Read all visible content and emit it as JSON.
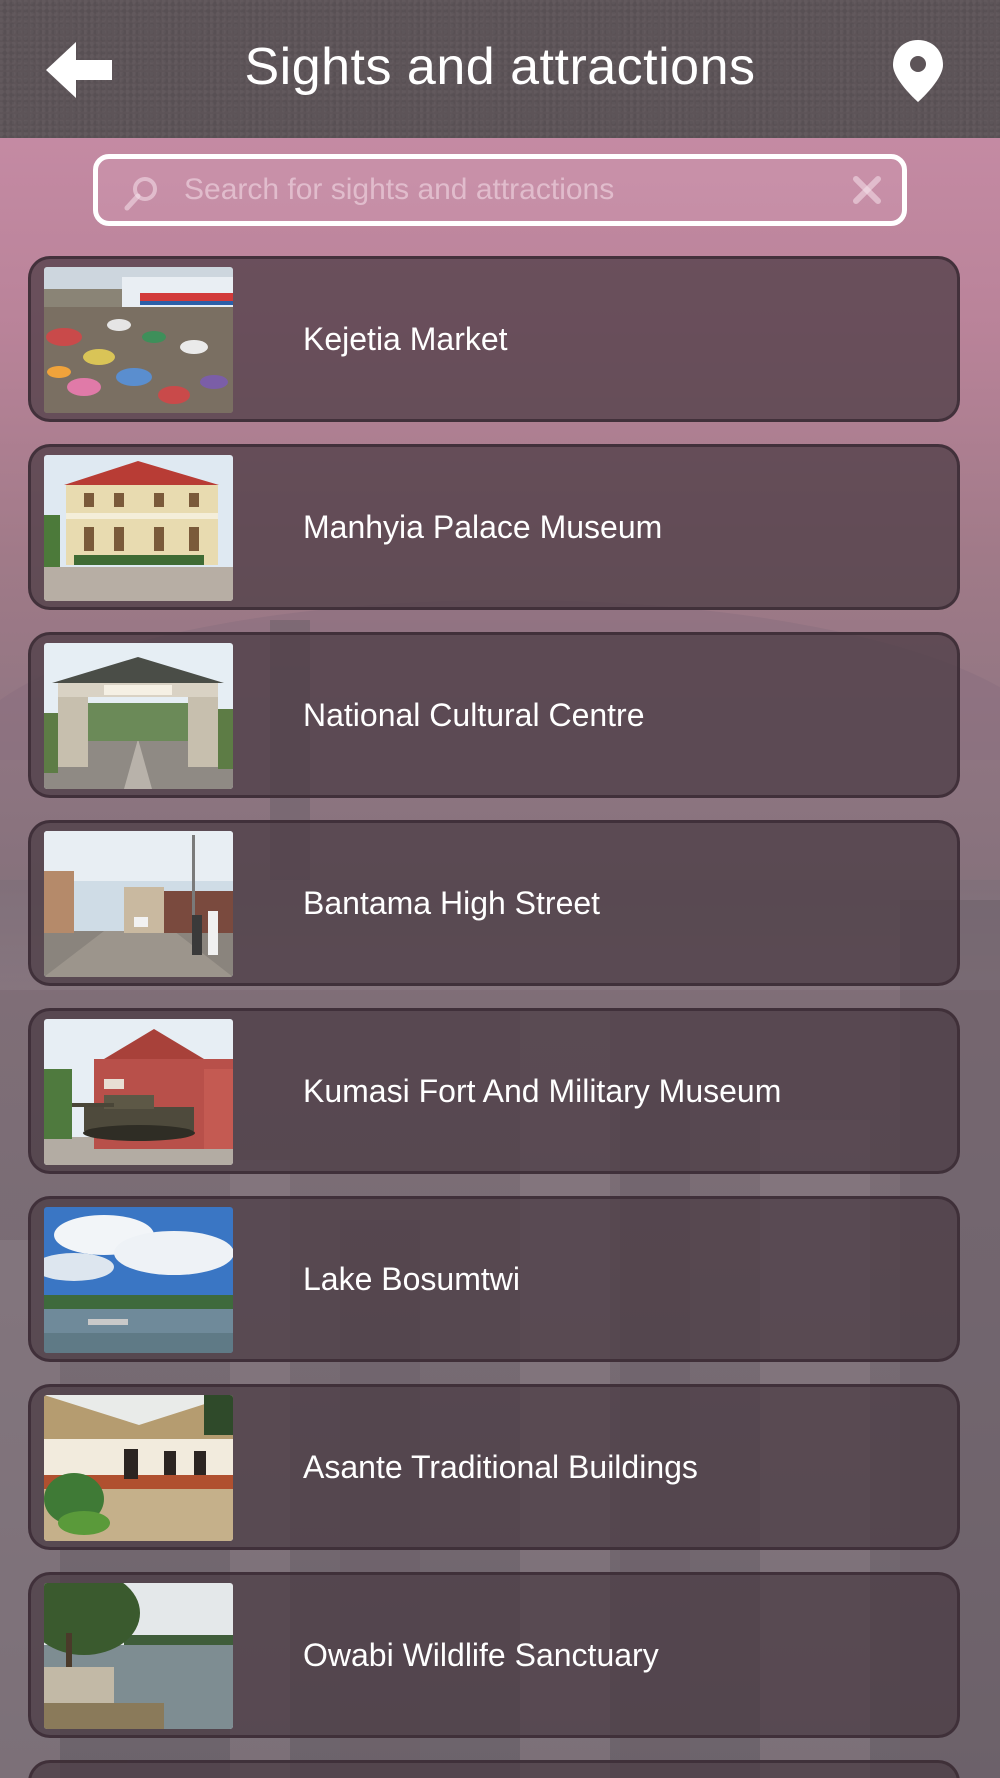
{
  "header": {
    "title": "Sights and attractions",
    "back_icon": "arrow-left-icon",
    "map_icon": "map-pin-icon"
  },
  "search": {
    "placeholder": "Search for sights and attractions",
    "value": "",
    "search_icon": "search-icon",
    "clear_icon": "close-icon"
  },
  "items": [
    {
      "label": "Kejetia Market",
      "image": "market-photo"
    },
    {
      "label": "Manhyia Palace Museum",
      "image": "palace-photo"
    },
    {
      "label": "National Cultural Centre",
      "image": "gate-photo"
    },
    {
      "label": "Bantama High Street",
      "image": "street-photo"
    },
    {
      "label": "Kumasi Fort And Military Museum",
      "image": "fort-photo"
    },
    {
      "label": "Lake Bosumtwi",
      "image": "lake-photo"
    },
    {
      "label": "Asante Traditional Buildings",
      "image": "buildings-photo"
    },
    {
      "label": "Owabi Wildlife Sanctuary",
      "image": "sanctuary-photo"
    }
  ],
  "colors": {
    "header_bg": "#5d5458",
    "item_bg": "#4a3a42",
    "text": "#ffffff",
    "sky": "#c98aa2"
  }
}
